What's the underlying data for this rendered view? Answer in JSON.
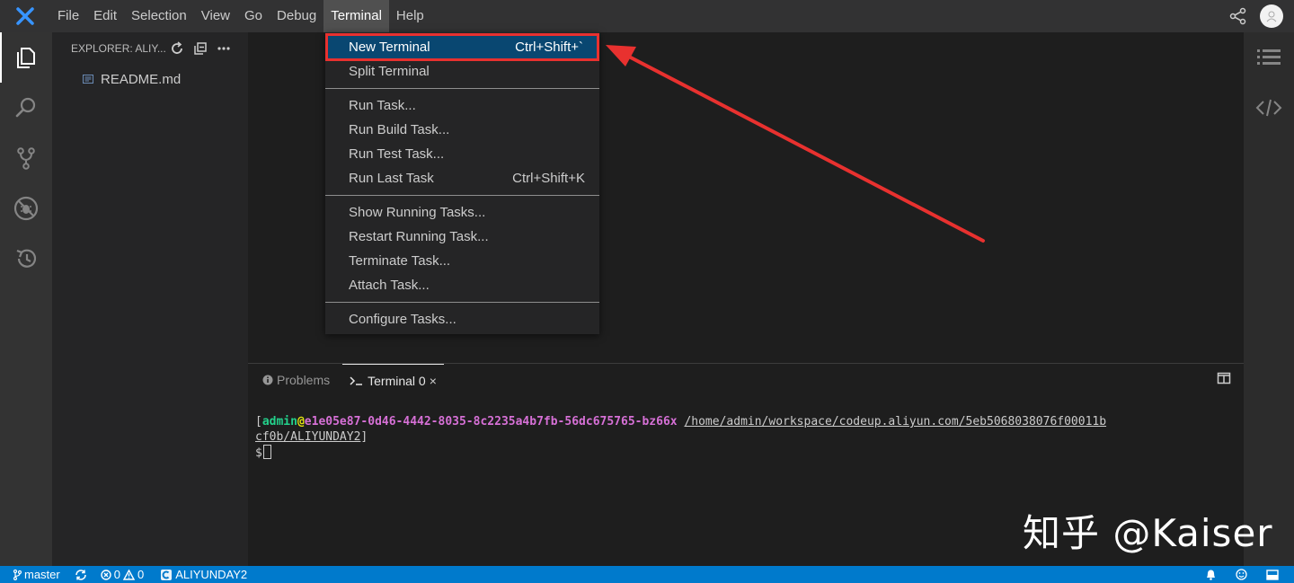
{
  "menubar": {
    "items": [
      "File",
      "Edit",
      "Selection",
      "View",
      "Go",
      "Debug",
      "Terminal",
      "Help"
    ],
    "active_index": 6
  },
  "activitybar": {
    "icons": [
      "files-icon",
      "search-icon",
      "source-control-icon",
      "debug-icon",
      "history-icon"
    ]
  },
  "sidebar": {
    "title": "EXPLORER: ALIY...",
    "files": [
      "README.md"
    ]
  },
  "terminal_menu": {
    "groups": [
      [
        {
          "label": "New Terminal",
          "shortcut": "Ctrl+Shift+`",
          "highlighted": true
        },
        {
          "label": "Split Terminal",
          "shortcut": ""
        }
      ],
      [
        {
          "label": "Run Task...",
          "shortcut": ""
        },
        {
          "label": "Run Build Task...",
          "shortcut": ""
        },
        {
          "label": "Run Test Task...",
          "shortcut": ""
        },
        {
          "label": "Run Last Task",
          "shortcut": "Ctrl+Shift+K"
        }
      ],
      [
        {
          "label": "Show Running Tasks...",
          "shortcut": ""
        },
        {
          "label": "Restart Running Task...",
          "shortcut": ""
        },
        {
          "label": "Terminate Task...",
          "shortcut": ""
        },
        {
          "label": "Attach Task...",
          "shortcut": ""
        }
      ],
      [
        {
          "label": "Configure Tasks...",
          "shortcut": ""
        }
      ]
    ]
  },
  "panel": {
    "tabs": {
      "problems": "Problems",
      "terminal": "Terminal 0"
    }
  },
  "terminal": {
    "user": "admin",
    "at": "@",
    "host": "e1e05e87-0d46-4442-8035-8c2235a4b7fb-56dc675765-bz66x",
    "path_line1": "/home/admin/workspace/codeup.aliyun.com/5eb5068038076f00011b",
    "path_line2": "cf0b/ALIYUNDAY2",
    "prompt": "$"
  },
  "statusbar": {
    "branch": "master",
    "errors": "0",
    "warnings": "0",
    "project": "ALIYUNDAY2"
  },
  "watermark": "知乎 @Kaiser",
  "colors": {
    "accent": "#007acc",
    "highlight": "#094771",
    "annotation": "#e8312f"
  }
}
